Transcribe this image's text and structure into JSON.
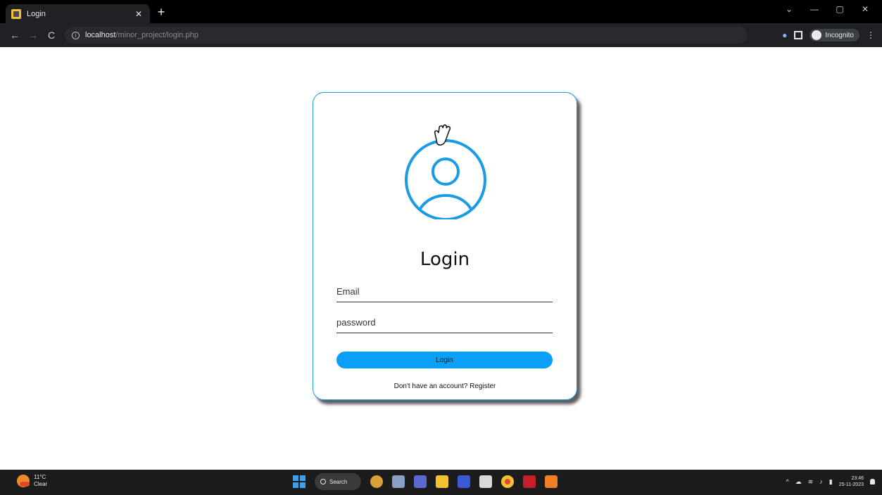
{
  "browser": {
    "tab_title": "Login",
    "tab_close": "✕",
    "new_tab": "+",
    "window_controls": {
      "dropdown": "⌄",
      "minimize": "—",
      "maximize": "▢",
      "close": "✕"
    },
    "nav": {
      "back": "←",
      "forward": "→",
      "reload": "C"
    },
    "url_host": "localhost",
    "url_path": "/minor_project/login.php",
    "incognito_label": "Incognito",
    "menu": "⋮",
    "accent": "#8ab4f8"
  },
  "login": {
    "title": "Login",
    "email_placeholder": "Email",
    "password_placeholder": "password",
    "button_label": "Login",
    "register_prompt": "Don't have an account?",
    "register_link": "Register",
    "accent_color": "#1a9be6",
    "button_color": "#0ba0f6"
  },
  "taskbar": {
    "weather_temp": "11°C",
    "weather_condition": "Clear",
    "search_label": "Search",
    "clock_time": "23:46",
    "clock_date": "25-11-2023",
    "tray_chevron": "^",
    "icons": [
      "start-icon",
      "search-icon",
      "copilot-icon",
      "widgets-icon",
      "teams-icon",
      "file-explorer-icon",
      "vscode-icon",
      "notes-icon",
      "chrome-icon",
      "mcafee-icon",
      "xampp-icon"
    ]
  }
}
